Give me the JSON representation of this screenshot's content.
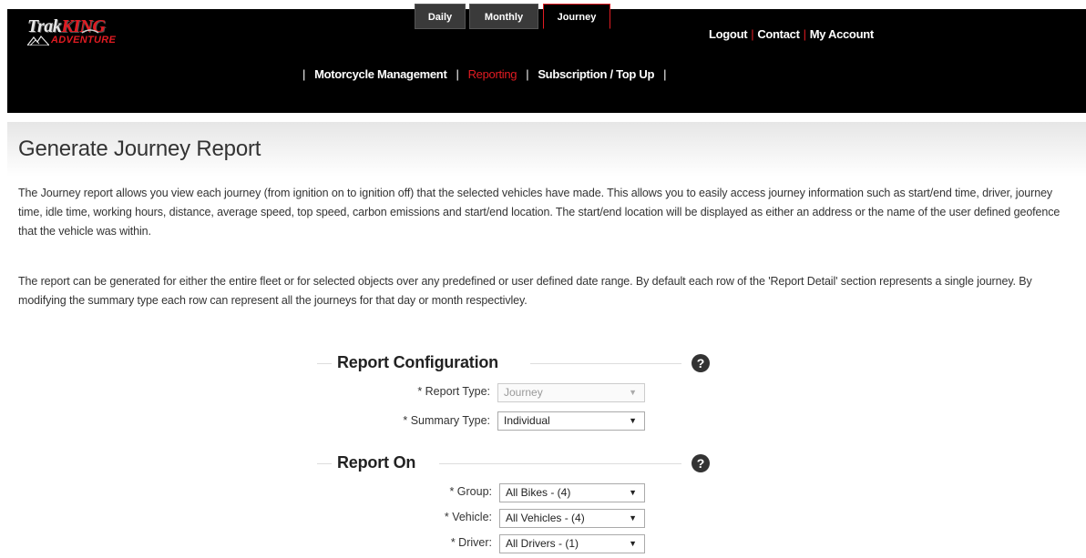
{
  "logo": {
    "line1_a": "Trak",
    "line1_b": "KING",
    "line2": "ADVENTURE"
  },
  "top_links": [
    "Logout",
    "Contact",
    "My Account"
  ],
  "main_nav": [
    {
      "label": "Motorcycle Management",
      "active": false
    },
    {
      "label": "Reporting",
      "active": true
    },
    {
      "label": "Subscription / Top Up",
      "active": false
    }
  ],
  "sub_nav": [
    {
      "label": "Daily",
      "active": false
    },
    {
      "label": "Monthly",
      "active": false
    },
    {
      "label": "Journey",
      "active": true
    }
  ],
  "page": {
    "title": "Generate Journey Report",
    "para1": "The Journey report allows you view each journey (from ignition on to ignition off) that the selected vehicles have made. This allows you to easily access journey information such as start/end time, driver, journey time, idle time, working hours, distance, average speed, top speed, carbon emissions and start/end location. The start/end location will be displayed as either an address or the name of the user defined geofence that the vehicle was within.",
    "para2": "The report can be generated for either the entire fleet or for selected objects over any predefined or user defined date range. By default each row of the 'Report Detail' section represents a single journey. By modifying the summary type each row can represent all the journeys for that day or month respectivley."
  },
  "report_configuration": {
    "title": "Report Configuration",
    "help": "?",
    "fields": [
      {
        "label": "* Report Type:",
        "value": "Journey",
        "disabled": true
      },
      {
        "label": "* Summary Type:",
        "value": "Individual",
        "disabled": false
      }
    ]
  },
  "report_on": {
    "title": "Report On",
    "help": "?",
    "fields": [
      {
        "label": "* Group:",
        "value": "All Bikes - (4)"
      },
      {
        "label": "* Vehicle:",
        "value": "All Vehicles - (4)"
      },
      {
        "label": "* Driver:",
        "value": "All Drivers - (1)"
      }
    ]
  },
  "colors": {
    "accent": "#e11b22",
    "header_bg": "#000000"
  }
}
